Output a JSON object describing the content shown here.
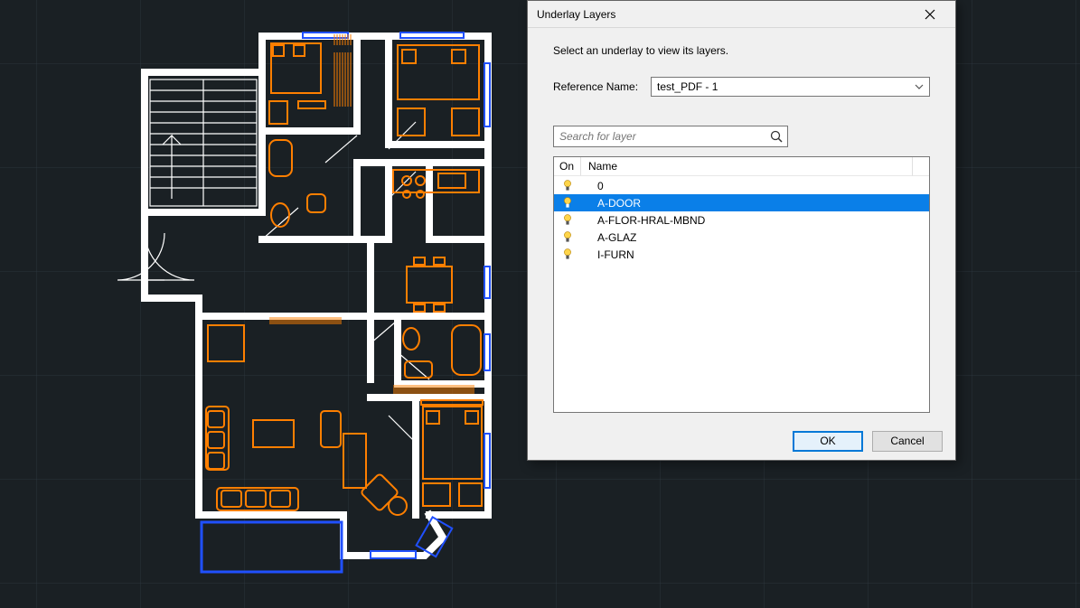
{
  "dialog": {
    "title": "Underlay Layers",
    "instruction": "Select an underlay to view its layers.",
    "reference_label": "Reference Name:",
    "reference_value": "test_PDF - 1",
    "search_placeholder": "Search for layer",
    "columns": {
      "on": "On",
      "name": "Name"
    },
    "layers": [
      {
        "name": "0",
        "on": true,
        "selected": false
      },
      {
        "name": "A-DOOR",
        "on": true,
        "selected": true
      },
      {
        "name": "A-FLOR-HRAL-MBND",
        "on": true,
        "selected": false
      },
      {
        "name": "A-GLAZ",
        "on": true,
        "selected": false
      },
      {
        "name": "I-FURN",
        "on": true,
        "selected": false
      }
    ],
    "ok_label": "OK",
    "cancel_label": "Cancel"
  },
  "colors": {
    "wall": "#ffffff",
    "furn": "#ff7f00",
    "glaz": "#0040ff",
    "door": "#ffffff",
    "hatch": "#ff7f00"
  }
}
